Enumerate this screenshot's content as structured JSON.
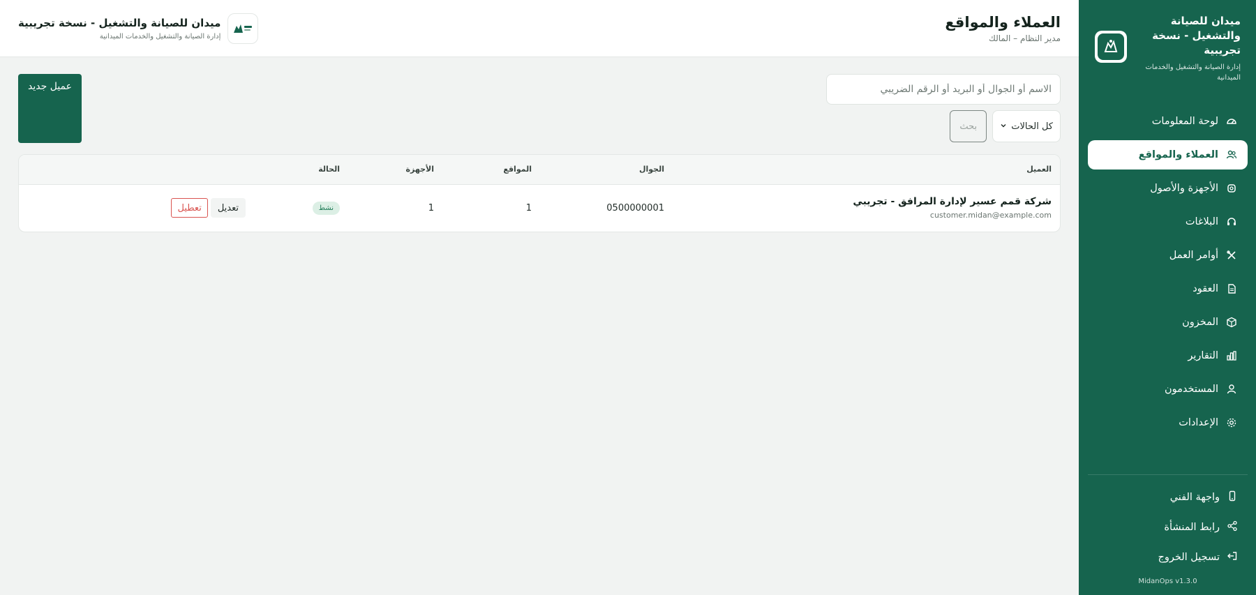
{
  "sidebar": {
    "title": "ميدان للصيانة والتشغيل - نسخة تجريبية",
    "subtitle": "إدارة الصيانة والتشغيل والخدمات الميدانية",
    "nav": [
      {
        "label": "لوحة المعلومات",
        "icon": "dashboard-icon"
      },
      {
        "label": "العملاء والمواقع",
        "icon": "users-icon",
        "active": true
      },
      {
        "label": "الأجهزة والأصول",
        "icon": "chip-icon"
      },
      {
        "label": "البلاغات",
        "icon": "headset-icon"
      },
      {
        "label": "أوامر العمل",
        "icon": "tools-icon"
      },
      {
        "label": "العقود",
        "icon": "document-icon"
      },
      {
        "label": "المخزون",
        "icon": "box-icon"
      },
      {
        "label": "التقارير",
        "icon": "bar-chart-icon"
      },
      {
        "label": "المستخدمون",
        "icon": "user-icon"
      },
      {
        "label": "الإعدادات",
        "icon": "gear-icon"
      }
    ],
    "bottom": [
      {
        "label": "واجهة الفني",
        "icon": "mobile-icon"
      },
      {
        "label": "رابط المنشأة",
        "icon": "share-icon"
      },
      {
        "label": "تسجيل الخروج",
        "icon": "logout-icon"
      }
    ],
    "version": "MidanOps v1.3.0"
  },
  "header": {
    "title": "العملاء والمواقع",
    "subtitle": "مدير النظام – المالك",
    "org_name": "ميدان للصيانة والتشغيل - نسخة تجريبية",
    "org_subtitle": "إدارة الصيانة والتشغيل والخدمات الميدانية"
  },
  "toolbar": {
    "search_placeholder": "الاسم أو الجوال أو البريد أو الرقم الضريبي",
    "status_filter": "كل الحالات",
    "search_button": "بحث",
    "new_customer_button": "عميل جديد"
  },
  "table": {
    "headers": {
      "customer": "العميل",
      "mobile": "الجوال",
      "sites": "المواقع",
      "devices": "الأجهزة",
      "status": "الحالة"
    },
    "rows": [
      {
        "name": "شركة قمم عسير لإدارة المرافق - تجريبي",
        "email": "customer.midan@example.com",
        "mobile": "0500000001",
        "sites": "1",
        "devices": "1",
        "status": "نشط",
        "edit": "تعديل",
        "disable": "تعطيل"
      }
    ]
  },
  "colors": {
    "brand": "#16644e",
    "danger": "#d9534f",
    "active_badge_bg": "#dcefe5"
  }
}
